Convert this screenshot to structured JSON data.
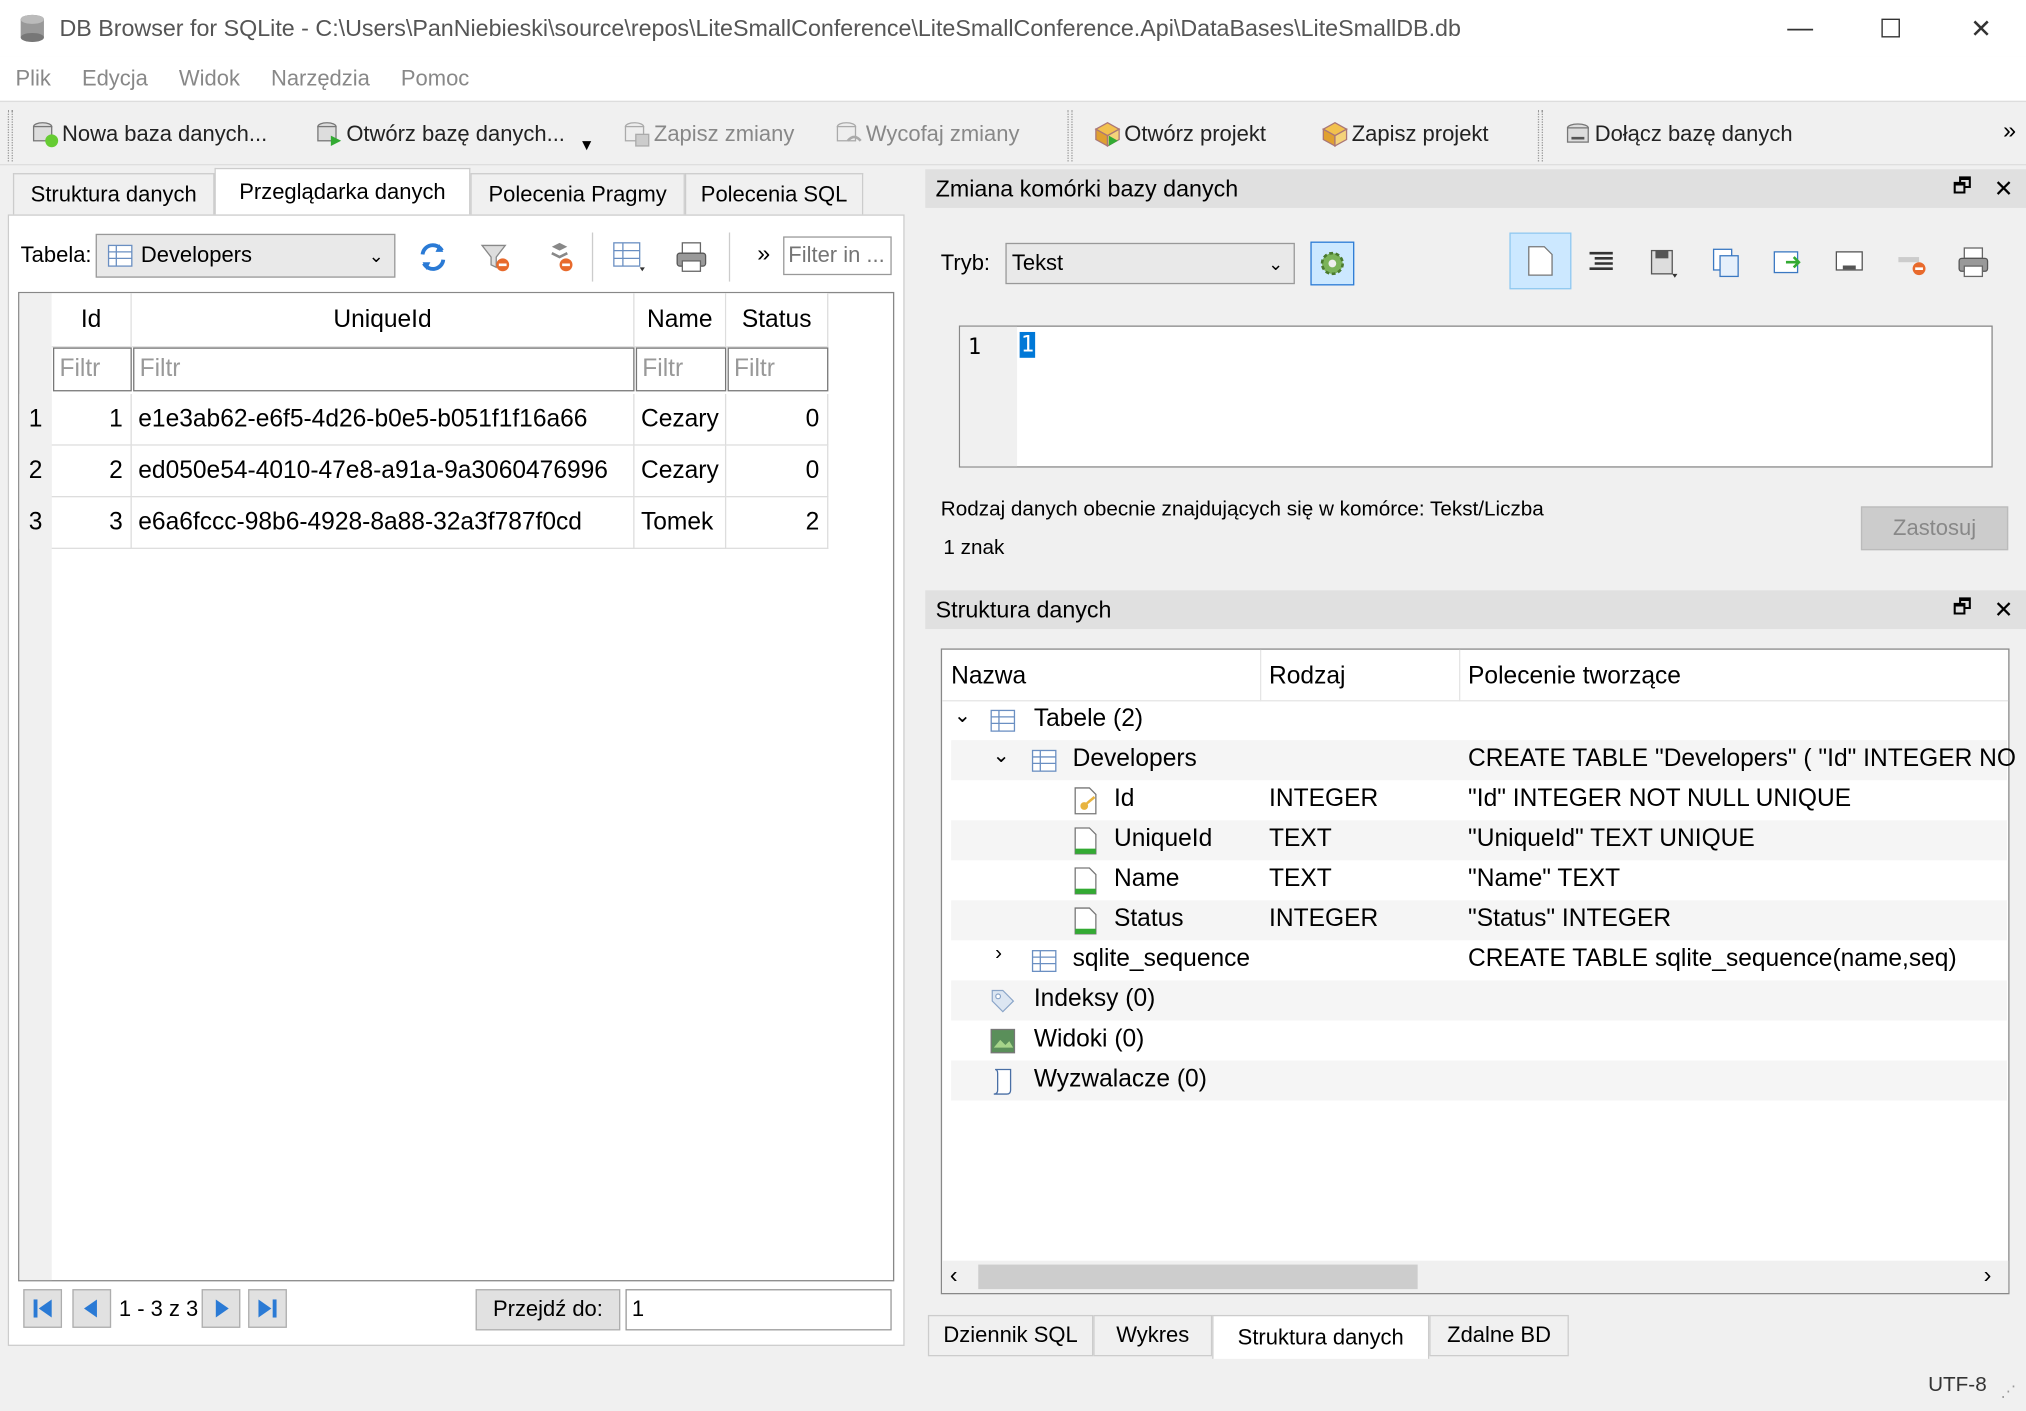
{
  "window": {
    "title": "DB Browser for SQLite - C:\\Users\\PanNiebieski\\source\\repos\\LiteSmallConference\\LiteSmallConference.Api\\DataBases\\LiteSmallDB.db",
    "minimize": "—",
    "maximize": "☐",
    "close": "✕"
  },
  "menu": [
    "Plik",
    "Edycja",
    "Widok",
    "Narzędzia",
    "Pomoc"
  ],
  "toolbar": {
    "new_db": "Nowa baza danych...",
    "open_db": "Otwórz bazę danych...",
    "write_changes": "Zapisz zmiany",
    "revert_changes": "Wycofaj zmiany",
    "open_project": "Otwórz projekt",
    "save_project": "Zapisz projekt",
    "attach_db": "Dołącz bazę danych",
    "overflow": "»"
  },
  "tabs": [
    "Struktura danych",
    "Przeglądarka danych",
    "Polecenia Pragmy",
    "Polecenia SQL"
  ],
  "browse": {
    "table_label": "Tabela:",
    "table_value": "Developers",
    "filter_placeholder": "Filter in ...",
    "more": "»",
    "columns": [
      "Id",
      "UniqueId",
      "Name",
      "Status"
    ],
    "filter_hint": "Filtr",
    "rows": [
      {
        "num": "1",
        "Id": "1",
        "UniqueId": "e1e3ab62-e6f5-4d26-b0e5-b051f1f16a66",
        "Name": "Cezary",
        "Status": "0"
      },
      {
        "num": "2",
        "Id": "2",
        "UniqueId": "ed050e54-4010-47e8-a91a-9a3060476996",
        "Name": "Cezary",
        "Status": "0"
      },
      {
        "num": "3",
        "Id": "3",
        "UniqueId": "e6a6fccc-98b6-4928-8a88-32a3f787f0cd",
        "Name": "Tomek",
        "Status": "2"
      }
    ],
    "record_count": "1 - 3 z 3",
    "goto_label": "Przejdź do:",
    "goto_value": "1"
  },
  "edit_cell": {
    "title": "Zmiana komórki bazy danych",
    "mode_label": "Tryb:",
    "mode_value": "Tekst",
    "line_no": "1",
    "cell_value": "1",
    "type_info": "Rodzaj danych obecnie znajdujących się w komórce: Tekst/Liczba",
    "char_count": "1 znak",
    "apply": "Zastosuj"
  },
  "structure": {
    "title": "Struktura danych",
    "headers": [
      "Nazwa",
      "Rodzaj",
      "Polecenie tworzące"
    ],
    "tables_label": "Tabele (2)",
    "developers": {
      "name": "Developers",
      "sql": "CREATE TABLE \"Developers\" ( \"Id\" INTEGER NO"
    },
    "fields": [
      {
        "name": "Id",
        "type": "INTEGER",
        "sql": "\"Id\" INTEGER NOT NULL UNIQUE"
      },
      {
        "name": "UniqueId",
        "type": "TEXT",
        "sql": "\"UniqueId\" TEXT UNIQUE"
      },
      {
        "name": "Name",
        "type": "TEXT",
        "sql": "\"Name\" TEXT"
      },
      {
        "name": "Status",
        "type": "INTEGER",
        "sql": "\"Status\" INTEGER"
      }
    ],
    "sqlite_seq": {
      "name": "sqlite_sequence",
      "sql": "CREATE TABLE sqlite_sequence(name,seq)"
    },
    "indexes": "Indeksy (0)",
    "views": "Widoki (0)",
    "triggers": "Wyzwalacze (0)"
  },
  "bottom_tabs": [
    "Dziennik SQL",
    "Wykres",
    "Struktura danych",
    "Zdalne BD"
  ],
  "status": {
    "encoding": "UTF-8"
  },
  "colors": {
    "accent": "#0078d7",
    "selection": "#cce8ff"
  }
}
